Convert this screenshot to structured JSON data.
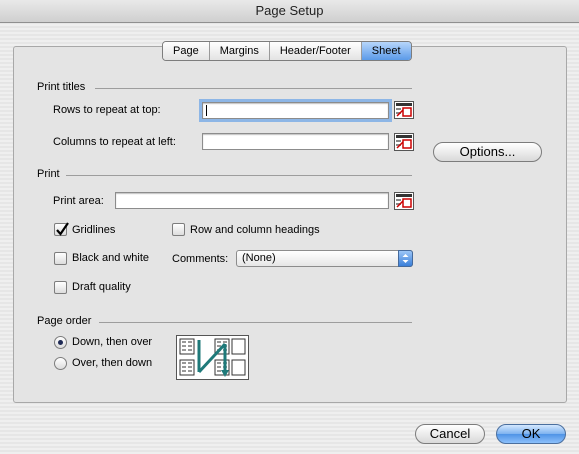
{
  "window": {
    "title": "Page Setup"
  },
  "tabs": [
    {
      "label": "Page"
    },
    {
      "label": "Margins"
    },
    {
      "label": "Header/Footer"
    },
    {
      "label": "Sheet",
      "active": true
    }
  ],
  "print_titles": {
    "heading": "Print titles",
    "rows_label": "Rows to repeat at top:",
    "rows_value": "",
    "cols_label": "Columns to repeat at left:",
    "cols_value": ""
  },
  "options_button": "Options...",
  "print": {
    "heading": "Print",
    "area_label": "Print area:",
    "area_value": "",
    "gridlines": {
      "label": "Gridlines",
      "checked": true
    },
    "row_col_headings": {
      "label": "Row and column headings",
      "checked": false
    },
    "black_white": {
      "label": "Black and white",
      "checked": false
    },
    "draft_quality": {
      "label": "Draft quality",
      "checked": false
    },
    "comments_label": "Comments:",
    "comments_value": "(None)"
  },
  "page_order": {
    "heading": "Page order",
    "down_over": {
      "label": "Down, then over",
      "selected": true
    },
    "over_down": {
      "label": "Over, then down",
      "selected": false
    }
  },
  "buttons": {
    "cancel": "Cancel",
    "ok": "OK"
  },
  "icons": {
    "range_picker": "collapse-dialog-icon",
    "order_preview": "page-order-preview-icon"
  },
  "colors": {
    "accent": "#5b9ae8",
    "arrow": "#1f7a7a"
  }
}
